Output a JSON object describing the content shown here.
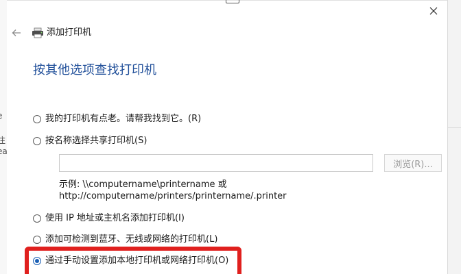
{
  "background": {
    "left_fragments": [
      "e",
      "注",
      "ea"
    ]
  },
  "window": {
    "title": "添加打印机",
    "back_icon": "back-arrow-icon",
    "close_icon": "close-icon",
    "app_icon": "printer-icon"
  },
  "page": {
    "heading": "按其他选项查找打印机"
  },
  "options": [
    {
      "label": "我的打印机有点老。请帮我找到它。(R)",
      "checked": false
    },
    {
      "label": "按名称选择共享打印机(S)",
      "checked": false
    },
    {
      "label": "使用 IP 地址或主机名添加打印机(I)",
      "checked": false
    },
    {
      "label": "添加可检测到蓝牙、无线或网络的打印机(L)",
      "checked": false
    },
    {
      "label": "通过手动设置添加本地打印机或网络打印机(O)",
      "checked": true
    }
  ],
  "shared_printer": {
    "input_value": "",
    "browse_label": "浏览(R)...",
    "example_line1": "示例: \\\\computername\\printername 或",
    "example_line2": "http://computername/printers/printername/.printer"
  },
  "colors": {
    "heading": "#1f4e99",
    "accent": "#1a5fb4",
    "highlight": "#e0201e"
  }
}
